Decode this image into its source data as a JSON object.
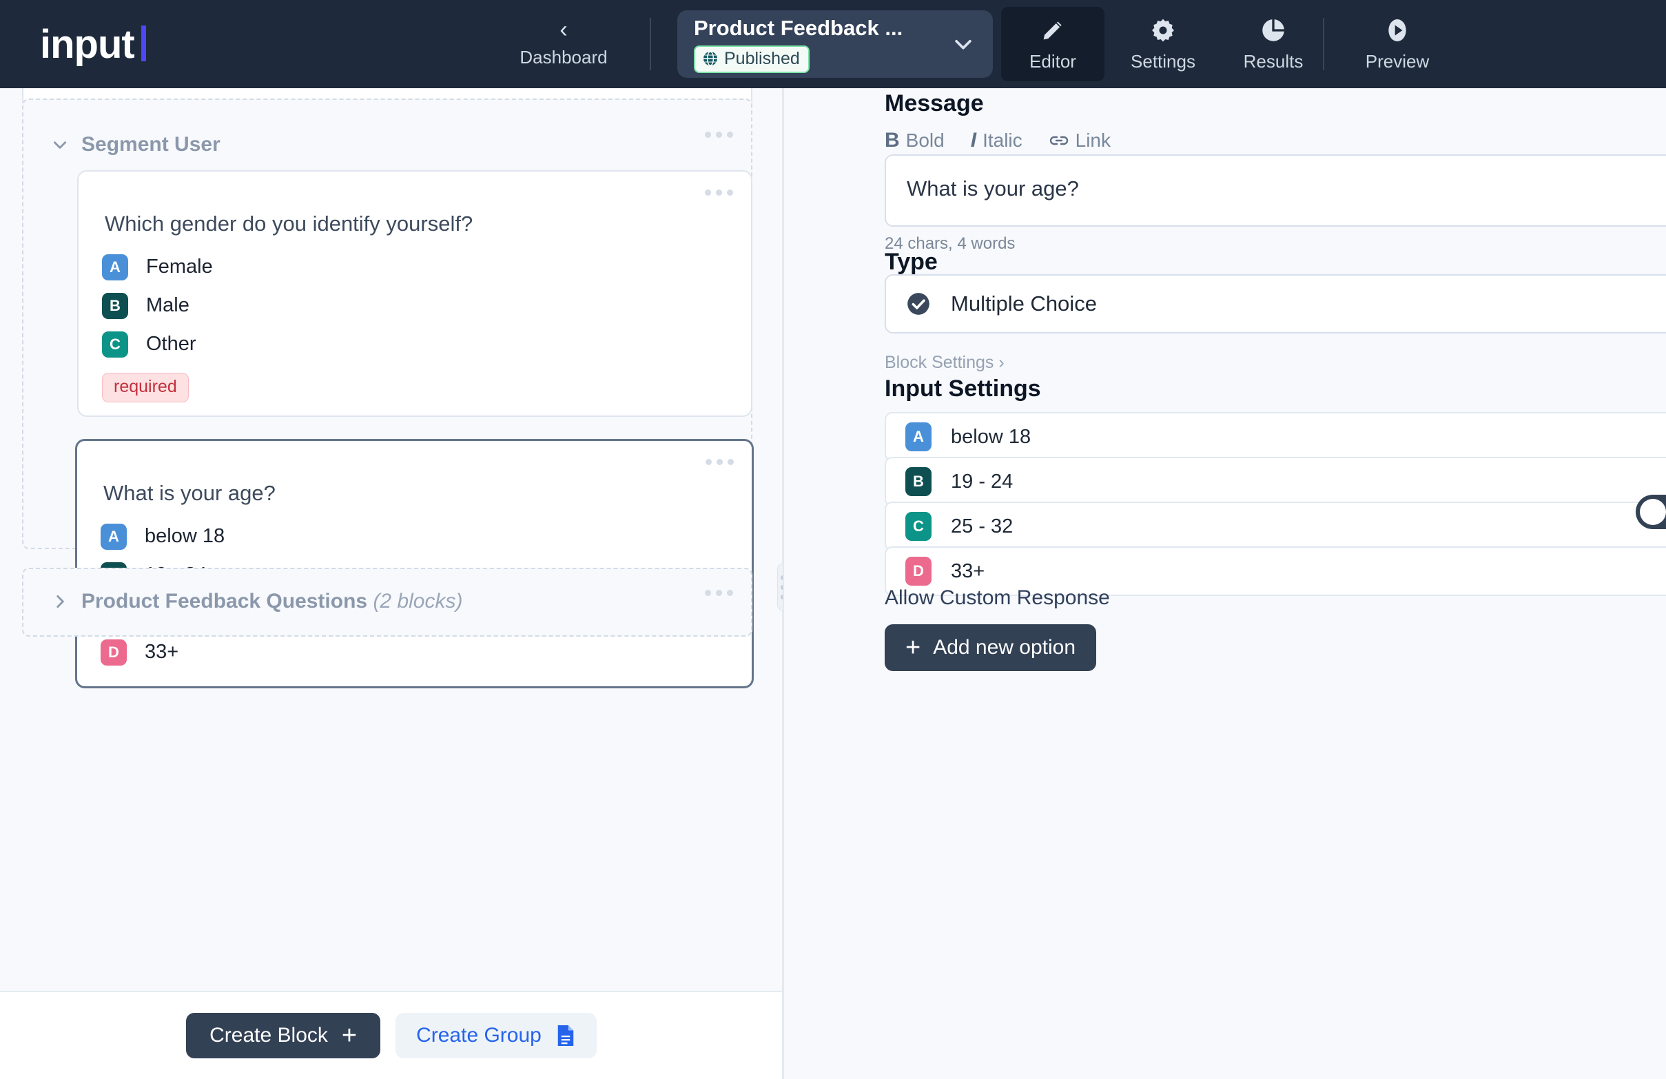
{
  "topbar": {
    "logo_text": "input",
    "dashboard_label": "Dashboard",
    "project_title": "Product Feedback ...",
    "published_label": "Published",
    "nav": [
      {
        "label": "Editor",
        "icon": "pencil-icon",
        "active": true
      },
      {
        "label": "Settings",
        "icon": "gear-icon",
        "active": false
      },
      {
        "label": "Results",
        "icon": "pie-chart-icon",
        "active": false
      },
      {
        "label": "Preview",
        "icon": "play-icon",
        "active": false
      }
    ]
  },
  "left_panel": {
    "group": {
      "title": "Segment User",
      "blocks": [
        {
          "question": "Which gender do you identify yourself?",
          "selected": false,
          "required_label": "required",
          "options": [
            {
              "key": "A",
              "label": "Female",
              "color": "#4a90d9"
            },
            {
              "key": "B",
              "label": "Male",
              "color": "#0e4f52"
            },
            {
              "key": "C",
              "label": "Other",
              "color": "#0d9488"
            }
          ]
        },
        {
          "question": "What is your age?",
          "selected": true,
          "options": [
            {
              "key": "A",
              "label": "below 18",
              "color": "#4a90d9"
            },
            {
              "key": "B",
              "label": "19 - 24",
              "color": "#0e4f52"
            },
            {
              "key": "C",
              "label": "25 - 32",
              "color": "#0d9488"
            },
            {
              "key": "D",
              "label": "33+",
              "color": "#ec6a8e"
            }
          ]
        }
      ]
    },
    "collapsed_group": {
      "title": "Product Feedback Questions",
      "count_label": "(2 blocks)"
    },
    "footer": {
      "create_block_label": "Create Block",
      "create_group_label": "Create Group"
    }
  },
  "right_panel": {
    "message": {
      "title": "Message",
      "format_bold": "Bold",
      "format_italic": "Italic",
      "format_link": "Link",
      "value": "What is your age?",
      "meta": "24 chars, 4 words"
    },
    "type": {
      "title": "Type",
      "selected": "Multiple Choice",
      "block_settings_label": "Block Settings ›"
    },
    "input_settings": {
      "title": "Input Settings",
      "options": [
        {
          "key": "A",
          "value": "below 18",
          "color": "#4a90d9"
        },
        {
          "key": "B",
          "value": "19 - 24",
          "color": "#0e4f52"
        },
        {
          "key": "C",
          "value": "25 - 32",
          "color": "#0d9488"
        },
        {
          "key": "D",
          "value": "33+",
          "color": "#ec6a8e"
        }
      ],
      "allow_custom_label": "Allow Custom Response",
      "allow_custom_value": "no",
      "add_option_label": "Add new option"
    }
  },
  "colors": {
    "nav_bg": "#1e2a3b",
    "accent_blue": "#2563eb",
    "dark_button": "#334155",
    "panel_bg": "#f7f9fc"
  }
}
